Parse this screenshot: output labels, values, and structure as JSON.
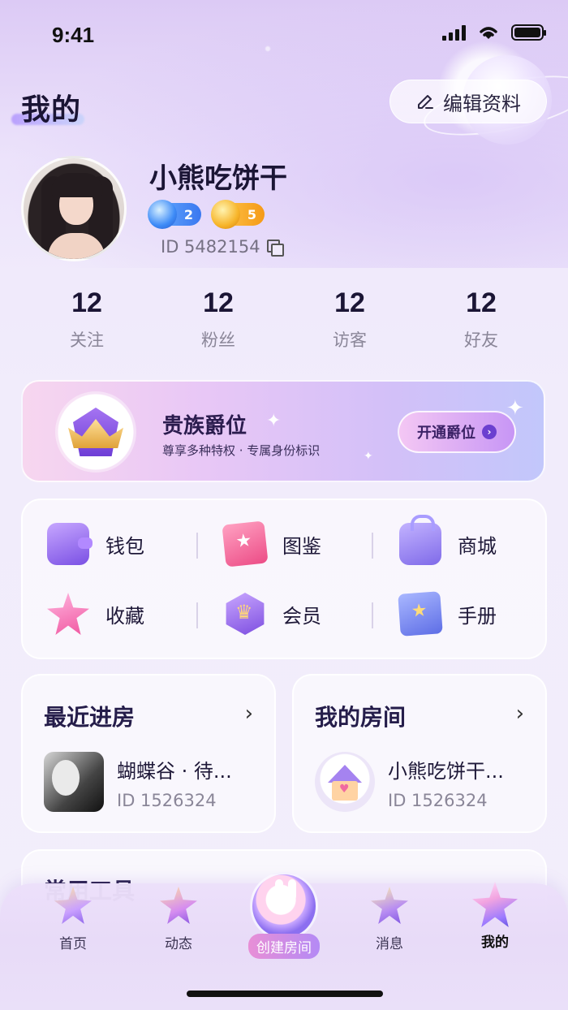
{
  "status": {
    "time": "9:41"
  },
  "header": {
    "title": "我的",
    "edit_label": "编辑资料"
  },
  "profile": {
    "nickname": "小熊吃饼干",
    "badge_blue_level": "2",
    "badge_gold_level": "5",
    "id_label": "ID 5482154"
  },
  "stats": [
    {
      "value": "12",
      "label": "关注"
    },
    {
      "value": "12",
      "label": "粉丝"
    },
    {
      "value": "12",
      "label": "访客"
    },
    {
      "value": "12",
      "label": "好友"
    }
  ],
  "noble": {
    "title": "贵族爵位",
    "subtitle": "尊享多种特权 · 专属身份标识",
    "button": "开通爵位"
  },
  "grid": [
    {
      "label": "钱包",
      "icon": "wallet-icon"
    },
    {
      "label": "图鉴",
      "icon": "book-icon"
    },
    {
      "label": "商城",
      "icon": "shopping-bag-icon"
    },
    {
      "label": "收藏",
      "icon": "star-icon"
    },
    {
      "label": "会员",
      "icon": "vip-crown-icon"
    },
    {
      "label": "手册",
      "icon": "manual-icon"
    }
  ],
  "recent_rooms": {
    "title": "最近进房",
    "room_name": "蝴蝶谷 · 待...",
    "room_id": "ID 1526324"
  },
  "my_room": {
    "title": "我的房间",
    "room_name": "小熊吃饼干...",
    "room_id": "ID 1526324"
  },
  "tools": {
    "title": "常用工具"
  },
  "tabbar": {
    "home": "首页",
    "feed": "动态",
    "create": "创建房间",
    "messages": "消息",
    "mine": "我的"
  },
  "colors": {
    "accent": "#7a50e4",
    "background": "#f1ecfb"
  }
}
